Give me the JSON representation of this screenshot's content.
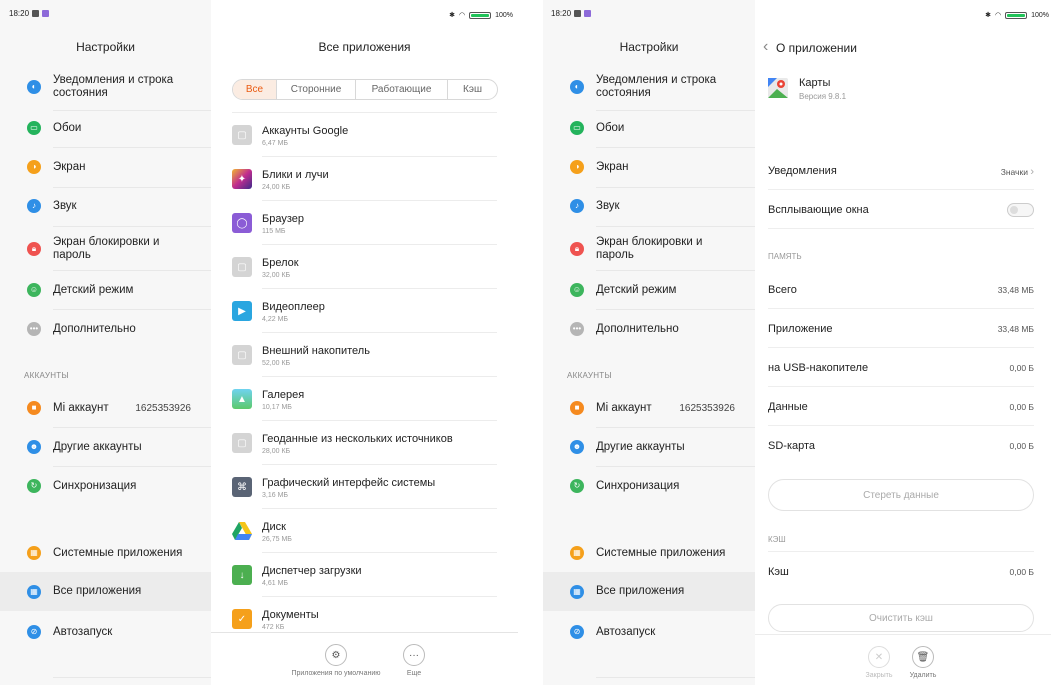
{
  "status": {
    "time": "18:20",
    "battery": "100%"
  },
  "settings": {
    "title": "Настройки",
    "items": [
      {
        "label": "Уведомления и строка состояния",
        "icon": "notification-icon",
        "color": "#2f8fe6"
      },
      {
        "label": "Обои",
        "icon": "wallpaper-icon",
        "color": "#24b35c"
      },
      {
        "label": "Экран",
        "icon": "display-icon",
        "color": "#f5a01b"
      },
      {
        "label": "Звук",
        "icon": "sound-icon",
        "color": "#2f8fe6"
      },
      {
        "label": "Экран блокировки и пароль",
        "icon": "lock-icon",
        "color": "#ef5350"
      },
      {
        "label": "Детский режим",
        "icon": "child-mode-icon",
        "color": "#3db55d"
      },
      {
        "label": "Дополнительно",
        "icon": "more-icon",
        "color": "#b5b5b5"
      }
    ],
    "accounts_header": "АККАУНТЫ",
    "accounts": [
      {
        "label": "Mi аккаунт",
        "value": "1625353926",
        "icon": "mi-account-icon",
        "color": "#f58a1f"
      },
      {
        "label": "Другие аккаунты",
        "icon": "accounts-icon",
        "color": "#2f8fe6"
      },
      {
        "label": "Синхронизация",
        "icon": "sync-icon",
        "color": "#3db55d"
      }
    ],
    "apps": [
      {
        "label": "Системные приложения",
        "icon": "system-apps-icon",
        "color": "#f5a01b"
      },
      {
        "label": "Все приложения",
        "icon": "all-apps-icon",
        "color": "#2f8fe6"
      },
      {
        "label": "Автозапуск",
        "icon": "autostart-icon",
        "color": "#2f8fe6"
      }
    ]
  },
  "all_apps": {
    "title": "Все приложения",
    "tabs": [
      "Все",
      "Сторонние",
      "Работающие",
      "Кэш"
    ],
    "active_tab": 0,
    "list": [
      {
        "name": "Аккаунты Google",
        "size": "6,47 МБ",
        "icon": "google-accounts-icon",
        "color": "#d4d4d4"
      },
      {
        "name": "Блики и лучи",
        "size": "24,00 КБ",
        "icon": "flares-icon",
        "color": "#8b3fb0"
      },
      {
        "name": "Браузер",
        "size": "115 МБ",
        "icon": "browser-icon",
        "color": "#8b5cd6"
      },
      {
        "name": "Брелок",
        "size": "32,00 КБ",
        "icon": "keychain-icon",
        "color": "#d4d4d4"
      },
      {
        "name": "Видеоплеер",
        "size": "4,22 МБ",
        "icon": "video-player-icon",
        "color": "#2aa6e0"
      },
      {
        "name": "Внешний накопитель",
        "size": "52,00 КБ",
        "icon": "external-storage-icon",
        "color": "#d4d4d4"
      },
      {
        "name": "Галерея",
        "size": "10,17 МБ",
        "icon": "gallery-icon",
        "color": "#4fc3a1"
      },
      {
        "name": "Геоданные из нескольких источников",
        "size": "28,00 КБ",
        "icon": "geodata-icon",
        "color": "#d4d4d4"
      },
      {
        "name": "Графический интерфейс системы",
        "size": "3,16 МБ",
        "icon": "system-ui-icon",
        "color": "#5a6475"
      },
      {
        "name": "Диск",
        "size": "26,75 МБ",
        "icon": "drive-icon",
        "color": "#f5c518"
      },
      {
        "name": "Диспетчер загрузки",
        "size": "4,61 МБ",
        "icon": "download-manager-icon",
        "color": "#4caf50"
      },
      {
        "name": "Документы",
        "size": "472 КБ",
        "icon": "documents-icon",
        "color": "#f5a01b"
      }
    ],
    "bottom": {
      "default_apps": "Приложения по умолчанию",
      "more": "Еще"
    }
  },
  "detail": {
    "title": "О приложении",
    "app_name": "Карты",
    "app_version": "Версия 9.8.1",
    "notifications_label": "Уведомления",
    "notifications_value": "Значки",
    "popups_label": "Всплывающие окна",
    "popups_enabled": false,
    "memory_header": "ПАМЯТЬ",
    "memory_rows": [
      {
        "label": "Всего",
        "value": "33,48 МБ"
      },
      {
        "label": "Приложение",
        "value": "33,48 МБ"
      },
      {
        "label": "на USB-накопителе",
        "value": "0,00 Б"
      },
      {
        "label": "Данные",
        "value": "0,00 Б"
      },
      {
        "label": "SD-карта",
        "value": "0,00 Б"
      }
    ],
    "clear_data": "Стереть данные",
    "cache_header": "КЭШ",
    "cache_label": "Кэш",
    "cache_value": "0,00 Б",
    "clear_cache": "Очистить кэш",
    "close_label": "Закрыть",
    "delete_label": "Удалить"
  }
}
